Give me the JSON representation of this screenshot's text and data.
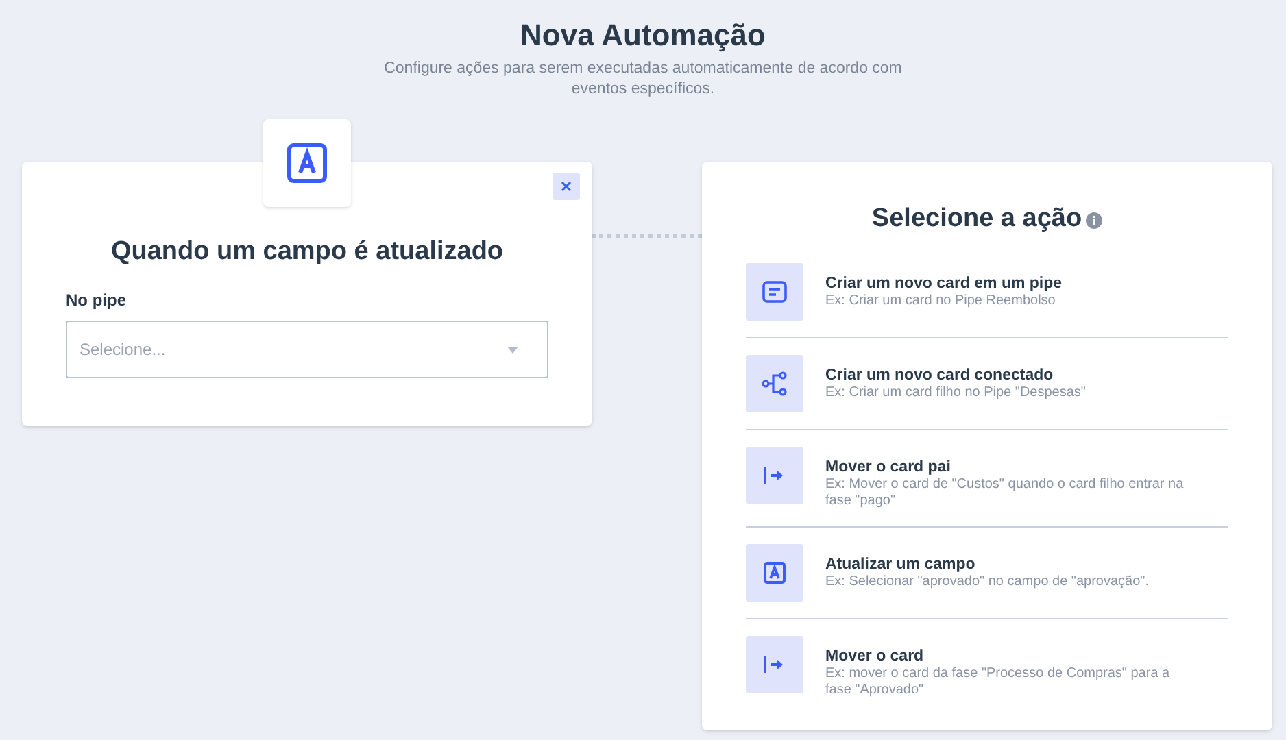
{
  "header": {
    "title": "Nova Automação",
    "subtitle": "Configure ações para serem executadas automaticamente de acordo com eventos específicos."
  },
  "trigger": {
    "title": "Quando um campo é atualizado",
    "field_label": "No pipe",
    "select": {
      "placeholder": "Selecione..."
    }
  },
  "actions_panel": {
    "title": "Selecione a ação",
    "actions": [
      {
        "kind": "card",
        "title": "Criar um novo card em um pipe",
        "example": "Ex: Criar um card no Pipe Reembolso"
      },
      {
        "kind": "connected",
        "title": "Criar um novo card conectado",
        "example": "Ex: Criar um card filho no Pipe \"Despesas\""
      },
      {
        "kind": "move",
        "title": "Mover o card pai",
        "example": "Ex: Mover o card de \"Custos\" quando o card filho entrar na fase \"pago\""
      },
      {
        "kind": "field",
        "title": "Atualizar um campo",
        "example": "Ex: Selecionar \"aprovado\" no campo de \"aprovação\"."
      },
      {
        "kind": "move",
        "title": "Mover o card",
        "example": "Ex: mover o card da fase \"Processo de Compras\" para a fase \"Aprovado\""
      }
    ]
  }
}
